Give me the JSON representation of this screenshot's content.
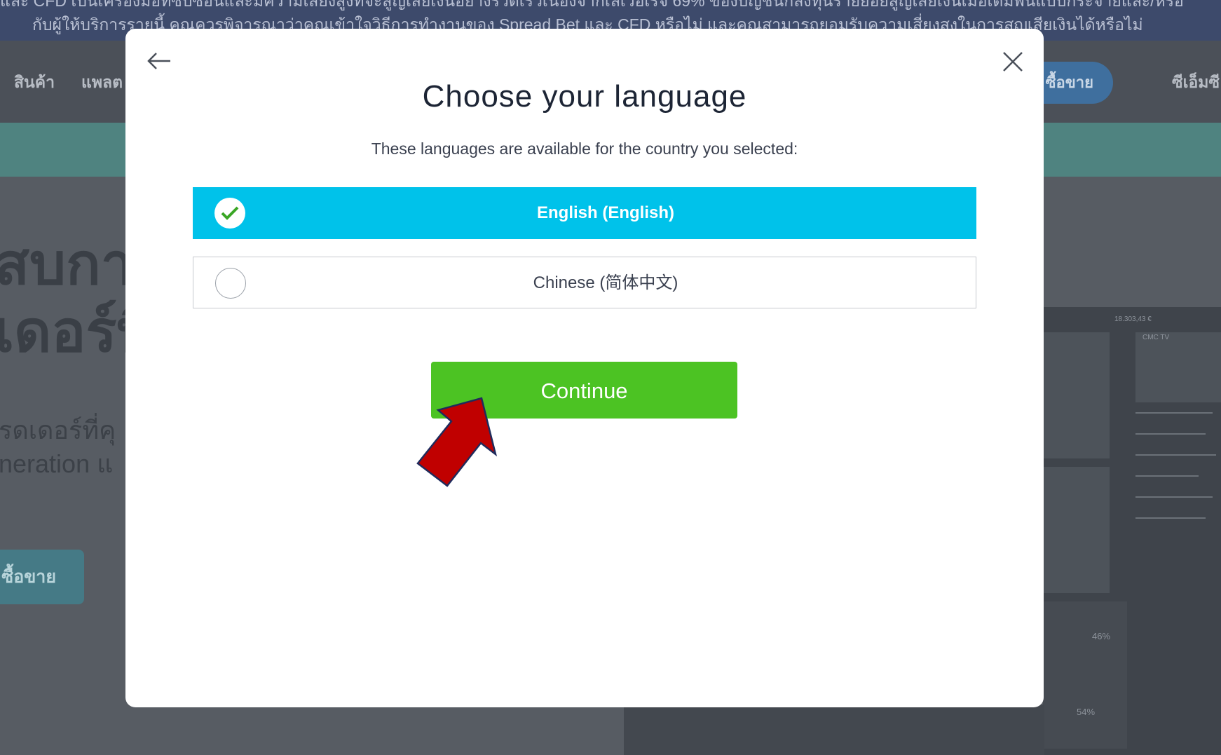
{
  "background": {
    "risk_banner": {
      "line1": "และ CFD เป็นเครื่องมือที่ซับซ้อนและมีความเสี่ยงสูงที่จะสูญเสียเงินอย่างรวดเร็วเนื่องจากเลเวอเรจ 69% ของบัญชีนักลงทุนรายย่อยสูญเสียเงินเมื่อเดิมพันแบบกระจายและ/หรือ",
      "line2": "กับผู้ให้บริการรายนี้ คุณควรพิจารณาว่าคุณเข้าใจวิธีการทำงานของ Spread Bet และ CFD หรือไม่ และคุณสามารถยอมรับความเสี่ยงสูงในการสูญเสียเงินได้หรือไม่"
    },
    "nav": {
      "products": "สินค้า",
      "platform": "แพลต",
      "trade_button": "ซื้อขาย",
      "cmc": "ซีเอ็มซี"
    },
    "hero": {
      "heading_line1": "สบการ",
      "heading_line2": "เดอร์ที",
      "sub_line1": "รดเดอร์ที่คุ",
      "sub_line2": "neration แ",
      "cta": "ซื้อขาย"
    },
    "platform_values": {
      "balance": "18.303,43 €",
      "pct1": "46%",
      "pct2": "54%",
      "cmc_tv": "CMC TV"
    }
  },
  "modal": {
    "title": "Choose your language",
    "subtitle": "These languages are available for the country you selected:",
    "languages": [
      {
        "label": "English (English)",
        "selected": true
      },
      {
        "label": "Chinese (简体中文)",
        "selected": false
      }
    ],
    "continue_label": "Continue"
  },
  "colors": {
    "selected_option": "#00c2ea",
    "continue_button": "#4cc323",
    "arrow_fill": "#c00000",
    "arrow_outline": "#1f2b5c"
  },
  "icons": {
    "back": "arrow-left-icon",
    "close": "close-icon",
    "checkmark": "checkmark-icon",
    "pointer": "red-pointer-arrow"
  }
}
